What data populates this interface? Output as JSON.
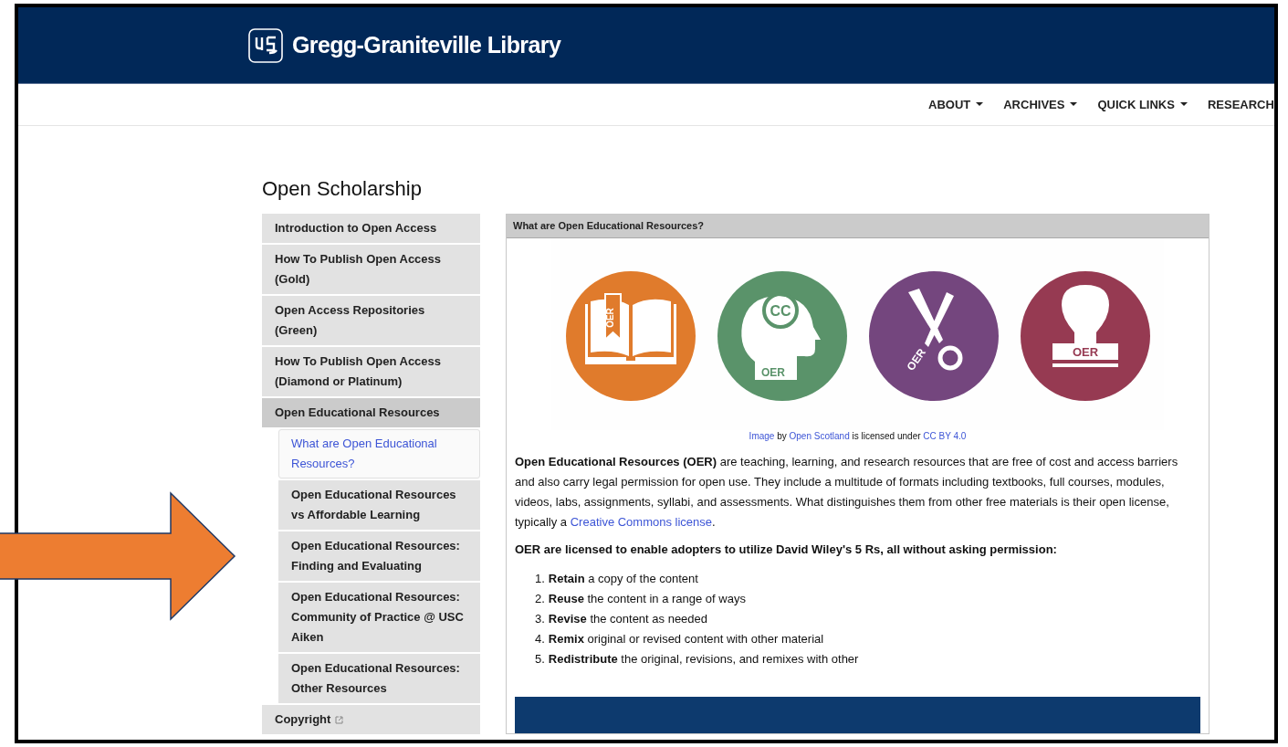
{
  "header": {
    "title": "Gregg-Graniteville Library"
  },
  "nav": [
    {
      "label": "ABOUT"
    },
    {
      "label": "ARCHIVES"
    },
    {
      "label": "QUICK LINKS"
    },
    {
      "label": "RESEARCH"
    }
  ],
  "page_title": "Open Scholarship",
  "sidebar": {
    "items": [
      {
        "label": "Introduction to Open Access",
        "selected": false
      },
      {
        "label": "How To Publish Open Access (Gold)",
        "selected": false
      },
      {
        "label": "Open Access Repositories (Green)",
        "selected": false
      },
      {
        "label": "How To Publish Open Access (Diamond or Platinum)",
        "selected": false
      },
      {
        "label": "Open Educational Resources",
        "selected": true,
        "children": [
          {
            "label": "What are Open Educational Resources?",
            "selected": true
          },
          {
            "label": "Open Educational Resources vs Affordable Learning",
            "selected": false
          },
          {
            "label": "Open Educational Resources: Finding and Evaluating",
            "selected": false
          },
          {
            "label": "Open Educational Resources: Community of Practice @ USC Aiken",
            "selected": false
          },
          {
            "label": "Open Educational Resources: Other Resources",
            "selected": false
          }
        ]
      },
      {
        "label": "Copyright",
        "selected": false,
        "external": true
      }
    ]
  },
  "panel": {
    "title": "What are Open Educational Resources?",
    "image": {
      "badges": [
        {
          "kind": "book",
          "label": "OER",
          "color": "#e07b2c"
        },
        {
          "kind": "head",
          "label": "CC",
          "sublabel": "OER",
          "color": "#5a936a"
        },
        {
          "kind": "scissors",
          "label": "OER",
          "color": "#74467e"
        },
        {
          "kind": "stamp",
          "label": "OER",
          "color": "#963a52"
        }
      ]
    },
    "caption": [
      {
        "text": "Image",
        "link": true
      },
      {
        "text": " by ",
        "link": false
      },
      {
        "text": "Open Scotland",
        "link": true
      },
      {
        "text": " is licensed under ",
        "link": false
      },
      {
        "text": "CC BY 4.0",
        "link": true
      }
    ],
    "paragraph": [
      {
        "text": "**Open Educational Resources (OER)** are teaching, learning, and research resources that are free of cost and access barriers and also carry legal permission for open use. They include a multitude of formats including textbooks, full courses, modules, videos, labs, assignments, syllabi, and assessments. What distinguishes them from other free materials is their open license, typically a ",
        "link": false
      },
      {
        "text": "Creative Commons license",
        "link": true
      },
      {
        "text": ".",
        "link": false
      }
    ],
    "list_heading": "OER are licensed to enable adopters to utilize David Wiley's 5 Rs, all without asking permission:",
    "list": [
      {
        "number": "1.",
        "text": "**Retain** a copy of the content"
      },
      {
        "number": "2.",
        "text": "**Reuse** the content in a range of ways"
      },
      {
        "number": "3.",
        "text": "**Revise** the content as needed"
      },
      {
        "number": "4.",
        "text": "**Remix** original or revised content with other material"
      },
      {
        "number": "5.",
        "text": "**Redistribute** the original, revisions, and remixes with other"
      }
    ]
  }
}
